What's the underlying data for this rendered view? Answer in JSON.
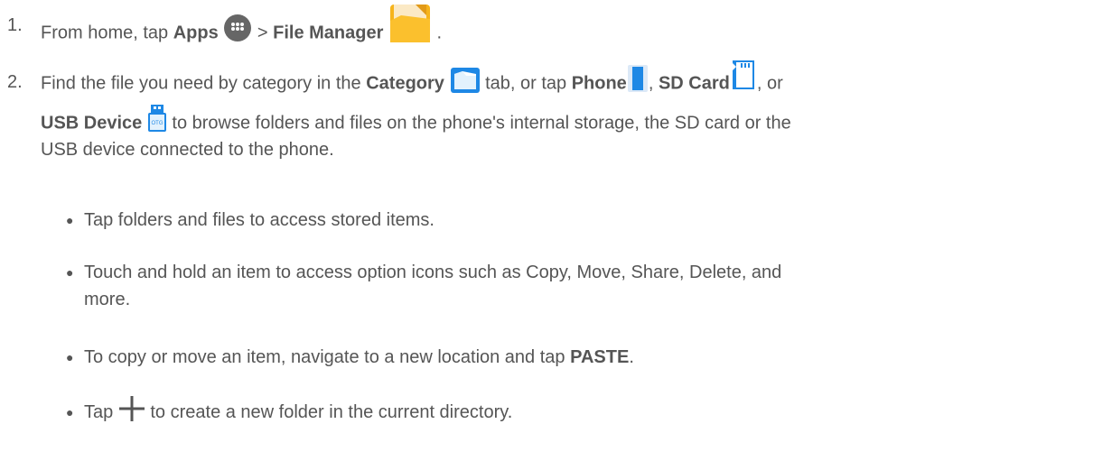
{
  "step1": {
    "number": "1.",
    "text_from_home": "From home, tap",
    "apps_label": "Apps",
    "separator": ">",
    "file_manager_label": "File Manager",
    "period": "."
  },
  "step2": {
    "number": "2.",
    "text_find": "Find the file you need by category in the",
    "category_label": "Category",
    "text_tab_or_tap": "tab, or tap",
    "phone_label": "Phone",
    "comma1": ",",
    "sd_card_label": "SD Card",
    "comma_or": ", or",
    "usb_device_label": "USB Device",
    "text_browse_1": "to browse folders and files on the phone's internal storage, the SD card or the",
    "text_browse_2": "USB device connected to the phone."
  },
  "bullets": [
    {
      "text": "Tap folders and files to access stored items."
    },
    {
      "text_1": "Touch and hold an item to access option icons such as Copy, Move, Share, Delete, and",
      "text_2": "more."
    },
    {
      "text_before": "To copy or move an item, navigate to a new location and tap",
      "paste_label": "PASTE",
      "period": "."
    },
    {
      "text_before": "Tap",
      "text_after": "to create a new folder in the current directory."
    }
  ],
  "bullet_glyph": "●",
  "icons": {
    "apps": "apps-icon",
    "file_manager": "file-manager-icon",
    "category": "category-tab-icon",
    "phone": "phone-storage-icon",
    "sd_card": "sd-card-icon",
    "usb": "usb-otg-icon",
    "plus": "plus-icon"
  },
  "colors": {
    "text": "#555555",
    "icon_blue": "#1e88e5",
    "folder_orange": "#f9a825"
  }
}
